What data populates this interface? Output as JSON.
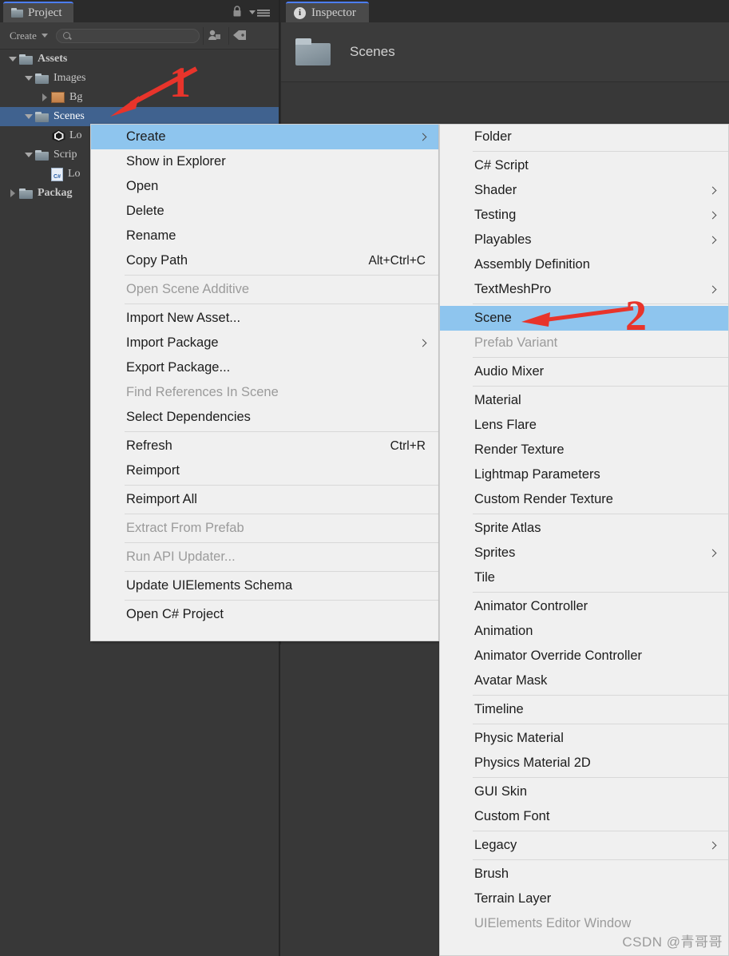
{
  "project_panel": {
    "tab_label": "Project",
    "tab_icon": "folder-icon",
    "lock_icon": "lock-icon",
    "menu_icon": "hamburger-menu-icon",
    "toolbar": {
      "create_label": "Create",
      "create_caret_icon": "chevron-down-icon",
      "search_icon": "search-icon",
      "search_value": "",
      "search_placeholder": "",
      "favorite_icon": "asset-filter-icon",
      "label_icon": "tag-icon"
    },
    "tree": [
      {
        "label": "Assets",
        "indent": 0,
        "twisty": "down",
        "icon": "folder-icon",
        "bold": true,
        "selected": false
      },
      {
        "label": "Images",
        "indent": 1,
        "twisty": "down",
        "icon": "folder-icon",
        "bold": false,
        "selected": false
      },
      {
        "label": "Bg",
        "indent": 2,
        "twisty": "right",
        "icon": "texture-icon",
        "bold": false,
        "selected": false
      },
      {
        "label": "Scenes",
        "indent": 1,
        "twisty": "down",
        "icon": "folder-icon",
        "bold": false,
        "selected": true
      },
      {
        "label": "Lo",
        "indent": 2,
        "twisty": "none",
        "icon": "unity-scene-icon",
        "bold": false,
        "selected": false
      },
      {
        "label": "Scrip",
        "indent": 1,
        "twisty": "down",
        "icon": "folder-icon",
        "bold": false,
        "selected": false
      },
      {
        "label": "Lo",
        "indent": 2,
        "twisty": "none",
        "icon": "csharp-script-icon",
        "bold": false,
        "selected": false
      },
      {
        "label": "Packag",
        "indent": 0,
        "twisty": "right",
        "icon": "folder-icon",
        "bold": true,
        "selected": false
      }
    ]
  },
  "inspector_panel": {
    "tab_label": "Inspector",
    "tab_icon": "info-icon",
    "asset_icon": "folder-icon",
    "asset_name": "Scenes"
  },
  "context_menu": {
    "items": [
      {
        "label": "Create",
        "shortcut": "",
        "state": "highlight",
        "submenu": true
      },
      {
        "type": "item",
        "label": "Show in Explorer",
        "shortcut": "",
        "state": "normal",
        "submenu": false
      },
      {
        "type": "item",
        "label": "Open",
        "shortcut": "",
        "state": "normal",
        "submenu": false
      },
      {
        "type": "item",
        "label": "Delete",
        "shortcut": "",
        "state": "normal",
        "submenu": false
      },
      {
        "type": "item",
        "label": "Rename",
        "shortcut": "",
        "state": "normal",
        "submenu": false
      },
      {
        "type": "item",
        "label": "Copy Path",
        "shortcut": "Alt+Ctrl+C",
        "state": "normal",
        "submenu": false
      },
      {
        "type": "sep"
      },
      {
        "type": "item",
        "label": "Open Scene Additive",
        "shortcut": "",
        "state": "disabled",
        "submenu": false
      },
      {
        "type": "sep"
      },
      {
        "type": "item",
        "label": "Import New Asset...",
        "shortcut": "",
        "state": "normal",
        "submenu": false
      },
      {
        "type": "item",
        "label": "Import Package",
        "shortcut": "",
        "state": "normal",
        "submenu": true
      },
      {
        "type": "item",
        "label": "Export Package...",
        "shortcut": "",
        "state": "normal",
        "submenu": false
      },
      {
        "type": "item",
        "label": "Find References In Scene",
        "shortcut": "",
        "state": "disabled",
        "submenu": false
      },
      {
        "type": "item",
        "label": "Select Dependencies",
        "shortcut": "",
        "state": "normal",
        "submenu": false
      },
      {
        "type": "sep"
      },
      {
        "type": "item",
        "label": "Refresh",
        "shortcut": "Ctrl+R",
        "state": "normal",
        "submenu": false
      },
      {
        "type": "item",
        "label": "Reimport",
        "shortcut": "",
        "state": "normal",
        "submenu": false
      },
      {
        "type": "sep"
      },
      {
        "type": "item",
        "label": "Reimport All",
        "shortcut": "",
        "state": "normal",
        "submenu": false
      },
      {
        "type": "sep"
      },
      {
        "type": "item",
        "label": "Extract From Prefab",
        "shortcut": "",
        "state": "disabled",
        "submenu": false
      },
      {
        "type": "sep"
      },
      {
        "type": "item",
        "label": "Run API Updater...",
        "shortcut": "",
        "state": "disabled",
        "submenu": false
      },
      {
        "type": "sep"
      },
      {
        "type": "item",
        "label": "Update UIElements Schema",
        "shortcut": "",
        "state": "normal",
        "submenu": false
      },
      {
        "type": "sep"
      },
      {
        "type": "item",
        "label": "Open C# Project",
        "shortcut": "",
        "state": "normal",
        "submenu": false
      }
    ]
  },
  "create_submenu": {
    "items": [
      {
        "type": "item",
        "label": "Folder",
        "state": "normal",
        "submenu": false
      },
      {
        "type": "sep"
      },
      {
        "type": "item",
        "label": "C# Script",
        "state": "normal",
        "submenu": false
      },
      {
        "type": "item",
        "label": "Shader",
        "state": "normal",
        "submenu": true
      },
      {
        "type": "item",
        "label": "Testing",
        "state": "normal",
        "submenu": true
      },
      {
        "type": "item",
        "label": "Playables",
        "state": "normal",
        "submenu": true
      },
      {
        "type": "item",
        "label": "Assembly Definition",
        "state": "normal",
        "submenu": false
      },
      {
        "type": "item",
        "label": "TextMeshPro",
        "state": "normal",
        "submenu": true
      },
      {
        "type": "sep"
      },
      {
        "type": "item",
        "label": "Scene",
        "state": "highlight",
        "submenu": false
      },
      {
        "type": "item",
        "label": "Prefab Variant",
        "state": "disabled",
        "submenu": false
      },
      {
        "type": "sep"
      },
      {
        "type": "item",
        "label": "Audio Mixer",
        "state": "normal",
        "submenu": false
      },
      {
        "type": "sep"
      },
      {
        "type": "item",
        "label": "Material",
        "state": "normal",
        "submenu": false
      },
      {
        "type": "item",
        "label": "Lens Flare",
        "state": "normal",
        "submenu": false
      },
      {
        "type": "item",
        "label": "Render Texture",
        "state": "normal",
        "submenu": false
      },
      {
        "type": "item",
        "label": "Lightmap Parameters",
        "state": "normal",
        "submenu": false
      },
      {
        "type": "item",
        "label": "Custom Render Texture",
        "state": "normal",
        "submenu": false
      },
      {
        "type": "sep"
      },
      {
        "type": "item",
        "label": "Sprite Atlas",
        "state": "normal",
        "submenu": false
      },
      {
        "type": "item",
        "label": "Sprites",
        "state": "normal",
        "submenu": true
      },
      {
        "type": "item",
        "label": "Tile",
        "state": "normal",
        "submenu": false
      },
      {
        "type": "sep"
      },
      {
        "type": "item",
        "label": "Animator Controller",
        "state": "normal",
        "submenu": false
      },
      {
        "type": "item",
        "label": "Animation",
        "state": "normal",
        "submenu": false
      },
      {
        "type": "item",
        "label": "Animator Override Controller",
        "state": "normal",
        "submenu": false
      },
      {
        "type": "item",
        "label": "Avatar Mask",
        "state": "normal",
        "submenu": false
      },
      {
        "type": "sep"
      },
      {
        "type": "item",
        "label": "Timeline",
        "state": "normal",
        "submenu": false
      },
      {
        "type": "sep"
      },
      {
        "type": "item",
        "label": "Physic Material",
        "state": "normal",
        "submenu": false
      },
      {
        "type": "item",
        "label": "Physics Material 2D",
        "state": "normal",
        "submenu": false
      },
      {
        "type": "sep"
      },
      {
        "type": "item",
        "label": "GUI Skin",
        "state": "normal",
        "submenu": false
      },
      {
        "type": "item",
        "label": "Custom Font",
        "state": "normal",
        "submenu": false
      },
      {
        "type": "sep"
      },
      {
        "type": "item",
        "label": "Legacy",
        "state": "normal",
        "submenu": true
      },
      {
        "type": "sep"
      },
      {
        "type": "item",
        "label": "Brush",
        "state": "normal",
        "submenu": false
      },
      {
        "type": "item",
        "label": "Terrain Layer",
        "state": "normal",
        "submenu": false
      },
      {
        "type": "item",
        "label": "UIElements Editor Window",
        "state": "disabled",
        "submenu": false
      }
    ]
  },
  "annotations": [
    {
      "label": "1",
      "color": "#e8342b",
      "target": "scenes-folder-row"
    },
    {
      "label": "2",
      "color": "#e8342b",
      "target": "submenu-item-scene"
    }
  ],
  "watermark": {
    "text": "CSDN @青哥哥"
  },
  "colors": {
    "panel_dark": "#383838",
    "tab_bar": "#2b2b2b",
    "selection_blue": "#40628f",
    "menu_bg": "#f0f0f0",
    "menu_highlight": "#8ec5ee",
    "annotation_red": "#e8342b",
    "tab_accent": "#4c7eff"
  }
}
